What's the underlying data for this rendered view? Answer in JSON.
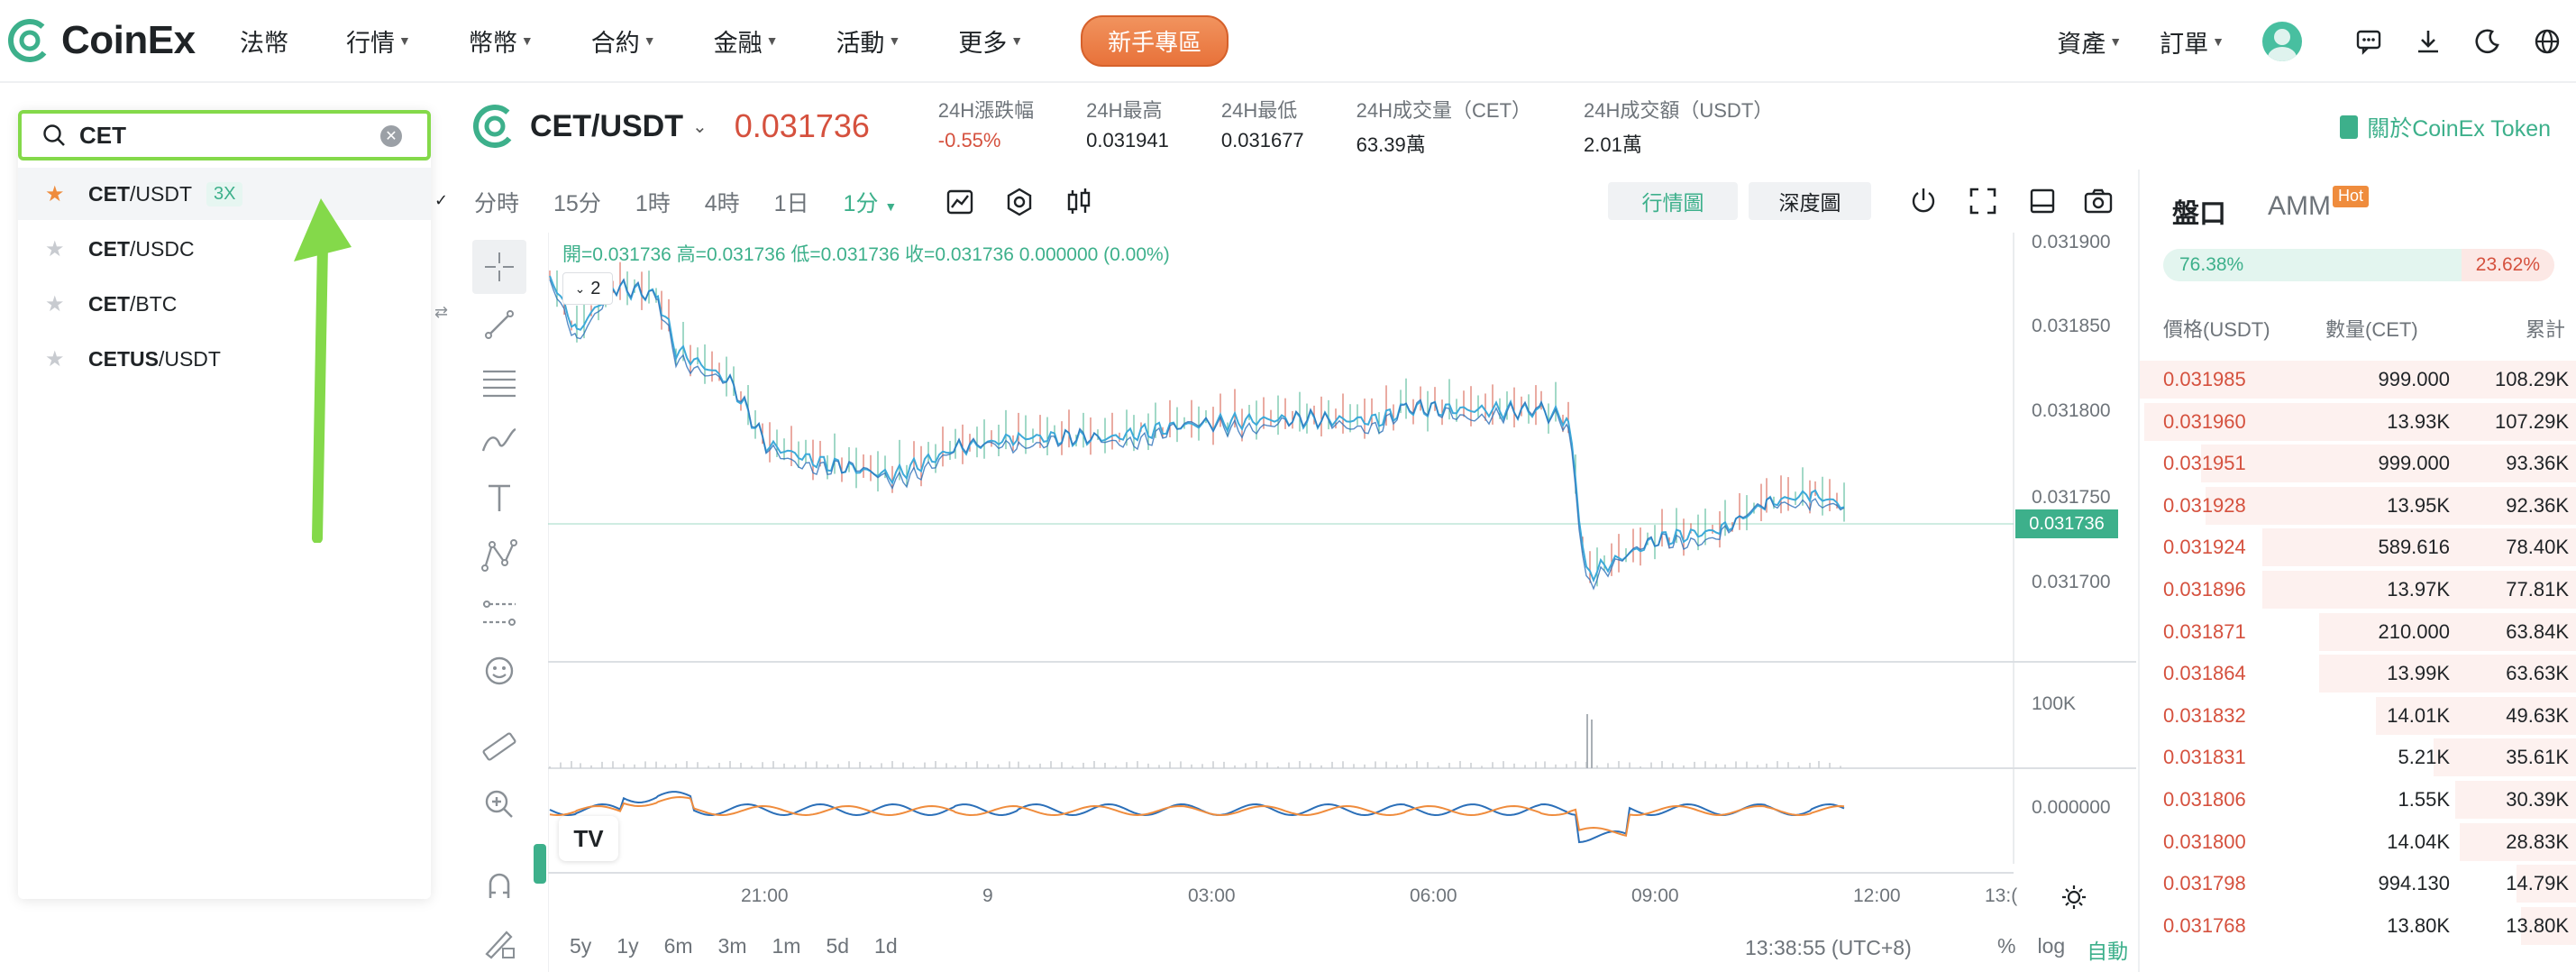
{
  "nav": {
    "logo_text": "CoinEx",
    "items": [
      {
        "label": "法幣",
        "caret": false
      },
      {
        "label": "行情",
        "caret": true
      },
      {
        "label": "幣幣",
        "caret": true
      },
      {
        "label": "合約",
        "caret": true
      },
      {
        "label": "金融",
        "caret": true
      },
      {
        "label": "活動",
        "caret": true
      },
      {
        "label": "更多",
        "caret": true
      }
    ],
    "promo": "新手專區",
    "assets": "資產",
    "orders": "訂單",
    "icons": [
      "message-icon",
      "download-icon",
      "moon-icon",
      "globe-icon"
    ]
  },
  "search": {
    "value": "CET",
    "results": [
      {
        "base": "CET",
        "quote": "/USDT",
        "leverage": "3X",
        "starred": true
      },
      {
        "base": "CET",
        "quote": "/USDC",
        "leverage": "",
        "starred": false
      },
      {
        "base": "CET",
        "quote": "/BTC",
        "leverage": "",
        "starred": false
      },
      {
        "base": "CETUS",
        "quote": "/USDT",
        "leverage": "",
        "starred": false
      }
    ]
  },
  "pair": {
    "name": "CET/USDT",
    "price": "0.031736",
    "stats": [
      {
        "label": "24H漲跌幅",
        "value": "-0.55%",
        "negative": true
      },
      {
        "label": "24H最高",
        "value": "0.031941",
        "negative": false
      },
      {
        "label": "24H最低",
        "value": "0.031677",
        "negative": false
      },
      {
        "label": "24H成交量（CET）",
        "value": "63.39萬",
        "negative": false
      },
      {
        "label": "24H成交額（USDT）",
        "value": "2.01萬",
        "negative": false
      }
    ],
    "about": "關於CoinEx Token"
  },
  "toolbar": {
    "timeframes": [
      "分時",
      "15分",
      "1時",
      "4時",
      "1日"
    ],
    "selected_tf": "1分",
    "view_chart": "行情圖",
    "view_depth": "深度圖"
  },
  "chart": {
    "ohlc": "開=0.031736  高=0.031736  低=0.031736  收=0.031736  0.000000 (0.00%)",
    "indicator_count": "2",
    "last_price": "0.031736",
    "y_ticks": [
      "0.031900",
      "0.031850",
      "0.031800",
      "0.031750",
      "0.031700"
    ],
    "volume_tick": "100K",
    "macd_tick": "0.000000",
    "x_ticks": [
      "21:00",
      "9",
      "03:00",
      "06:00",
      "09:00",
      "12:00",
      "13:("
    ],
    "ranges": [
      "5y",
      "1y",
      "6m",
      "3m",
      "1m",
      "5d",
      "1d"
    ],
    "clock": "13:38:55 (UTC+8)",
    "scale_pct": "%",
    "scale_log": "log",
    "scale_auto": "自動",
    "tv_logo": "TV"
  },
  "book": {
    "tab_book": "盤口",
    "tab_amm": "AMM",
    "hot": "Hot",
    "buy_ratio": "76.38%",
    "sell_ratio": "23.62%",
    "buy_fraction": 0.7638,
    "head_price": "價格(USDT)",
    "head_qty": "數量(CET)",
    "head_total": "累計",
    "asks": [
      {
        "price": "0.031985",
        "qty": "999.000",
        "total": "108.29K",
        "depth": 1.0
      },
      {
        "price": "0.031960",
        "qty": "13.93K",
        "total": "107.29K",
        "depth": 0.99
      },
      {
        "price": "0.031951",
        "qty": "999.000",
        "total": "93.36K",
        "depth": 0.86
      },
      {
        "price": "0.031928",
        "qty": "13.95K",
        "total": "92.36K",
        "depth": 0.85
      },
      {
        "price": "0.031924",
        "qty": "589.616",
        "total": "78.40K",
        "depth": 0.72
      },
      {
        "price": "0.031896",
        "qty": "13.97K",
        "total": "77.81K",
        "depth": 0.72
      },
      {
        "price": "0.031871",
        "qty": "210.000",
        "total": "63.84K",
        "depth": 0.59
      },
      {
        "price": "0.031864",
        "qty": "13.99K",
        "total": "63.63K",
        "depth": 0.59
      },
      {
        "price": "0.031832",
        "qty": "14.01K",
        "total": "49.63K",
        "depth": 0.46
      },
      {
        "price": "0.031831",
        "qty": "5.21K",
        "total": "35.61K",
        "depth": 0.33
      },
      {
        "price": "0.031806",
        "qty": "1.55K",
        "total": "30.39K",
        "depth": 0.28
      },
      {
        "price": "0.031800",
        "qty": "14.04K",
        "total": "28.83K",
        "depth": 0.27
      },
      {
        "price": "0.031798",
        "qty": "994.130",
        "total": "14.79K",
        "depth": 0.14
      },
      {
        "price": "0.031768",
        "qty": "13.80K",
        "total": "13.80K",
        "depth": 0.13
      }
    ]
  },
  "colors": {
    "brand": "#3db08b",
    "down": "#d5513e",
    "promo": "#e8723a",
    "search_highlight": "#84d94a",
    "ma_line": "#3da9d9"
  }
}
